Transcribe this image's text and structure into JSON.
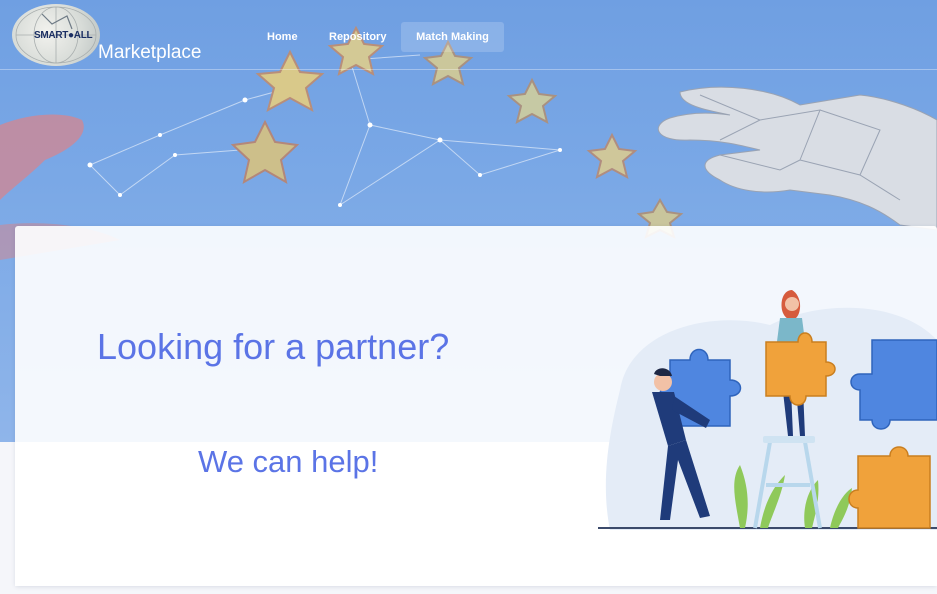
{
  "header": {
    "logo_text": "SMART●ALL",
    "brand": "Marketplace",
    "nav": [
      {
        "label": "Home"
      },
      {
        "label": "Repository"
      },
      {
        "label": "Match Making",
        "active": true
      }
    ]
  },
  "hero_card": {
    "headline": "Looking for a partner?",
    "subheadline": "We can help!"
  },
  "colors": {
    "accent_text": "#5b74e6",
    "hero_blue": "#7aa8e6",
    "puzzle_orange": "#f0a23b",
    "puzzle_blue": "#4f86e0"
  }
}
